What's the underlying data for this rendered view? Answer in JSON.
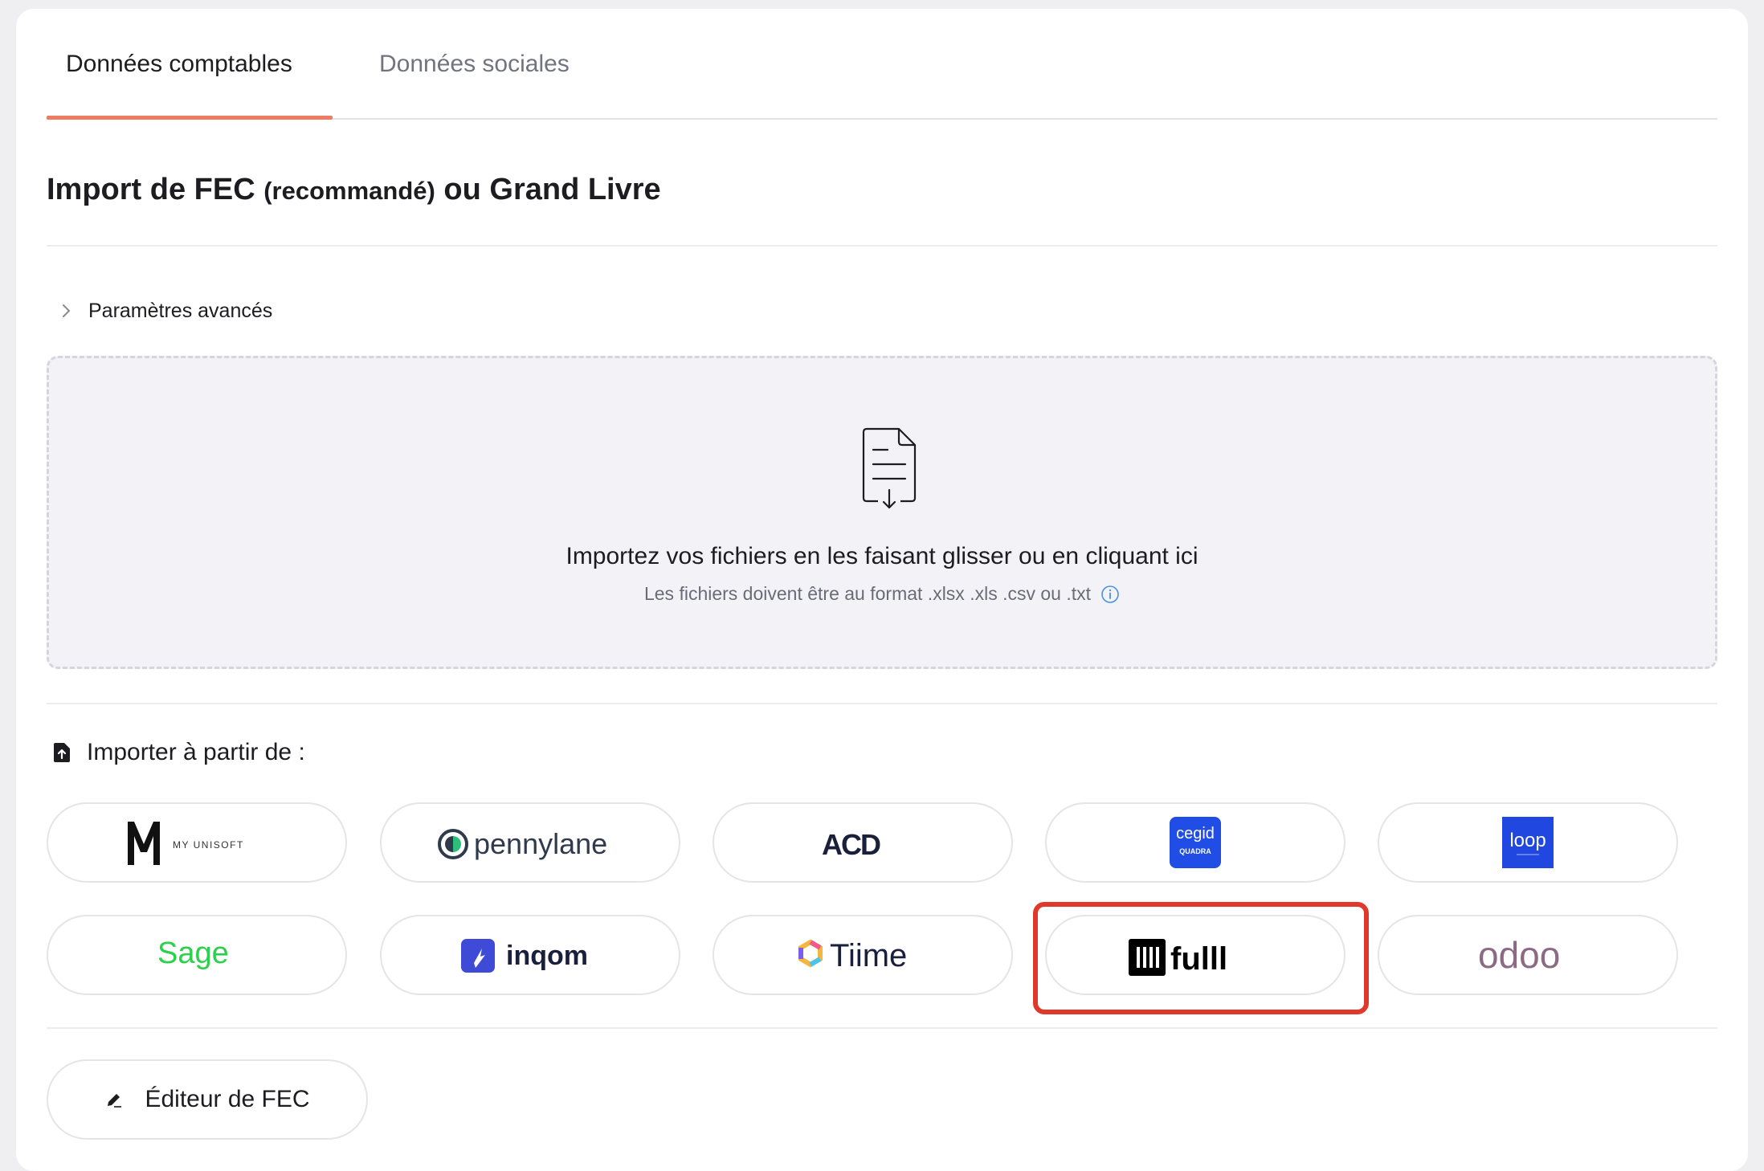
{
  "tabs": [
    {
      "label": "Données comptables",
      "active": true
    },
    {
      "label": "Données sociales",
      "active": false
    }
  ],
  "section": {
    "title_main": "Import de FEC ",
    "title_paren": "(recommandé)",
    "title_end": " ou Grand Livre"
  },
  "advanced": {
    "label": "Paramètres avancés"
  },
  "dropzone": {
    "main": "Importez vos fichiers en les faisant glisser ou en cliquant ici",
    "sub": "Les fichiers doivent être au format .xlsx .xls .csv ou .txt"
  },
  "import_from": {
    "label": "Importer à partir de :"
  },
  "integrations": [
    {
      "name": "myunisoft",
      "text": "MY UNISOFT"
    },
    {
      "name": "pennylane",
      "text": "pennylane"
    },
    {
      "name": "acd",
      "text": "ACD"
    },
    {
      "name": "cegid",
      "text": "cegid",
      "subtext": "QUADRA"
    },
    {
      "name": "loop",
      "text": "loop"
    },
    {
      "name": "sage",
      "text": "Sage"
    },
    {
      "name": "inqom",
      "text": "inqom"
    },
    {
      "name": "tiime",
      "text": "Tiime"
    },
    {
      "name": "fulll",
      "text": "fulll"
    },
    {
      "name": "odoo",
      "text": "odoo"
    }
  ],
  "editor": {
    "label": "Éditeur de FEC"
  },
  "colors": {
    "accent": "#ef7b63",
    "highlight": "#e0382a",
    "sage": "#2bd14b",
    "pennylane": "#2f3a4d",
    "cegid": "#1f4de6",
    "loop": "#2048e0",
    "inqom": "#3f4ad6",
    "odoo": "#8c6a84"
  }
}
